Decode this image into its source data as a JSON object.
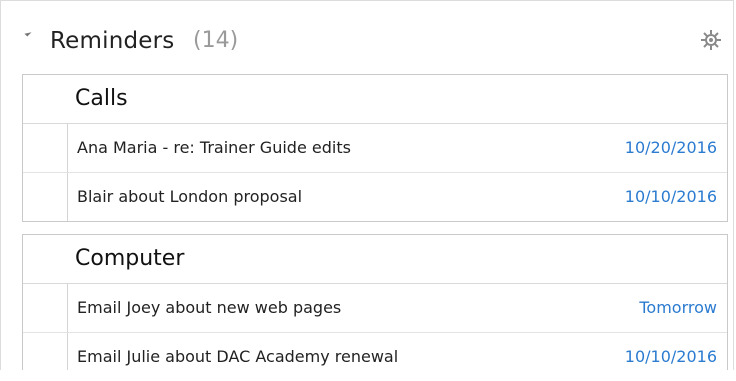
{
  "panel": {
    "title": "Reminders",
    "count": "(14)"
  },
  "groups": [
    {
      "title": "Calls",
      "items": [
        {
          "subject": "Ana Maria - re: Trainer Guide edits",
          "due": "10/20/2016"
        },
        {
          "subject": "Blair about London proposal",
          "due": "10/10/2016"
        }
      ]
    },
    {
      "title": "Computer",
      "items": [
        {
          "subject": "Email Joey about new web pages",
          "due": "Tomorrow"
        },
        {
          "subject": "Email Julie about DAC Academy renewal",
          "due": "10/10/2016"
        }
      ]
    }
  ],
  "colors": {
    "due_link": "#2b7bd0",
    "count_gray": "#9a9a9a"
  },
  "icons": {
    "collapse": "triangle-collapse-icon",
    "settings": "gear-icon"
  }
}
